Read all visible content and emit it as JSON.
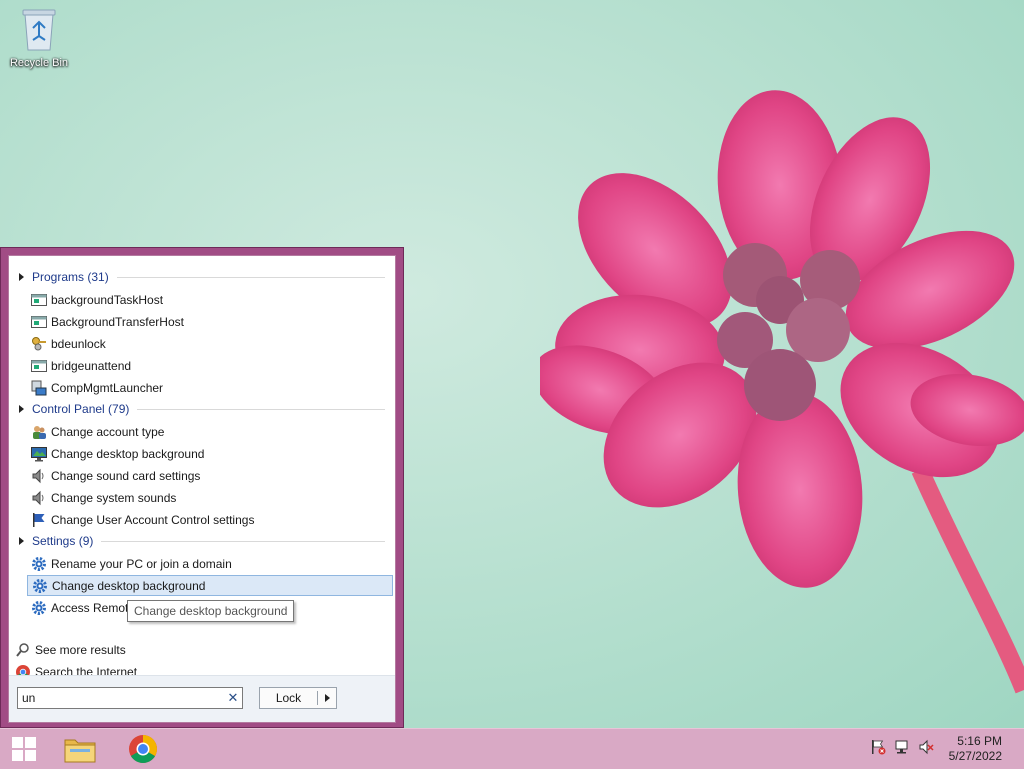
{
  "desktop": {
    "recycle_bin_label": "Recycle Bin"
  },
  "start_menu": {
    "sections": {
      "programs": {
        "header": "Programs (31)",
        "items": [
          "backgroundTaskHost",
          "BackgroundTransferHost",
          "bdeunlock",
          "bridgeunattend",
          "CompMgmtLauncher"
        ]
      },
      "control_panel": {
        "header": "Control Panel (79)",
        "items": [
          "Change account type",
          "Change desktop background",
          "Change sound card settings",
          "Change system sounds",
          "Change User Account Control settings"
        ]
      },
      "settings": {
        "header": "Settings (9)",
        "items": [
          "Rename your PC or join a domain",
          "Change desktop background",
          "Access RemoteApp and desktops"
        ]
      }
    },
    "tooltip": "Change desktop background",
    "see_more": "See more results",
    "search_internet": "Search the Internet",
    "search_value": "un",
    "lock_label": "Lock"
  },
  "taskbar": {
    "time": "5:16 PM",
    "date": "5/27/2022"
  },
  "colors": {
    "menu_frame": "#a14c85",
    "taskbar": "#d9a9c5",
    "selected_bg": "#dbe8f7",
    "header_text": "#1e3a8a"
  }
}
